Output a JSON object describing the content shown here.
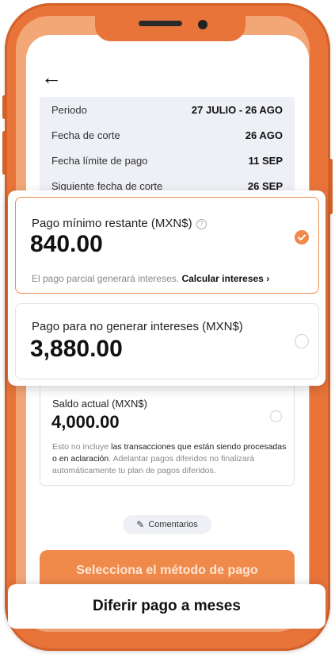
{
  "nav": {
    "back_icon": "←"
  },
  "statement": {
    "rows": [
      {
        "label": "Periodo",
        "value": "27 JULIO - 26 AGO"
      },
      {
        "label": "Fecha de corte",
        "value": "26 AGO"
      },
      {
        "label": "Fecha límite de pago",
        "value": "11 SEP"
      },
      {
        "label": "Siguiente fecha de corte",
        "value": "26 SEP"
      }
    ]
  },
  "options": {
    "minimum": {
      "label": "Pago mínimo restante (MXN$)",
      "help_icon": "?",
      "amount": "840.00",
      "note": "El pago parcial generará intereses.",
      "link": "Calcular intereses ›",
      "selected": true
    },
    "no_interest": {
      "label": "Pago para no generar intereses (MXN$)",
      "amount": "3,880.00",
      "selected": false
    }
  },
  "balance": {
    "label": "Saldo actual (MXN$)",
    "amount": "4,000.00",
    "note_part1": "Esto no incluye",
    "note_part2": "las transacciones que están siendo procesadas o en aclaración",
    "note_part3": ". Adelantar pagos diferidos no finalizará automáticamente tu plan de pagos diferidos."
  },
  "comments": {
    "label": "Comentarios"
  },
  "actions": {
    "select_method": "Selecciona el método de pago",
    "defer": "Diferir pago a meses"
  },
  "colors": {
    "accent": "#f08a4b",
    "frame": "#e8743a"
  }
}
